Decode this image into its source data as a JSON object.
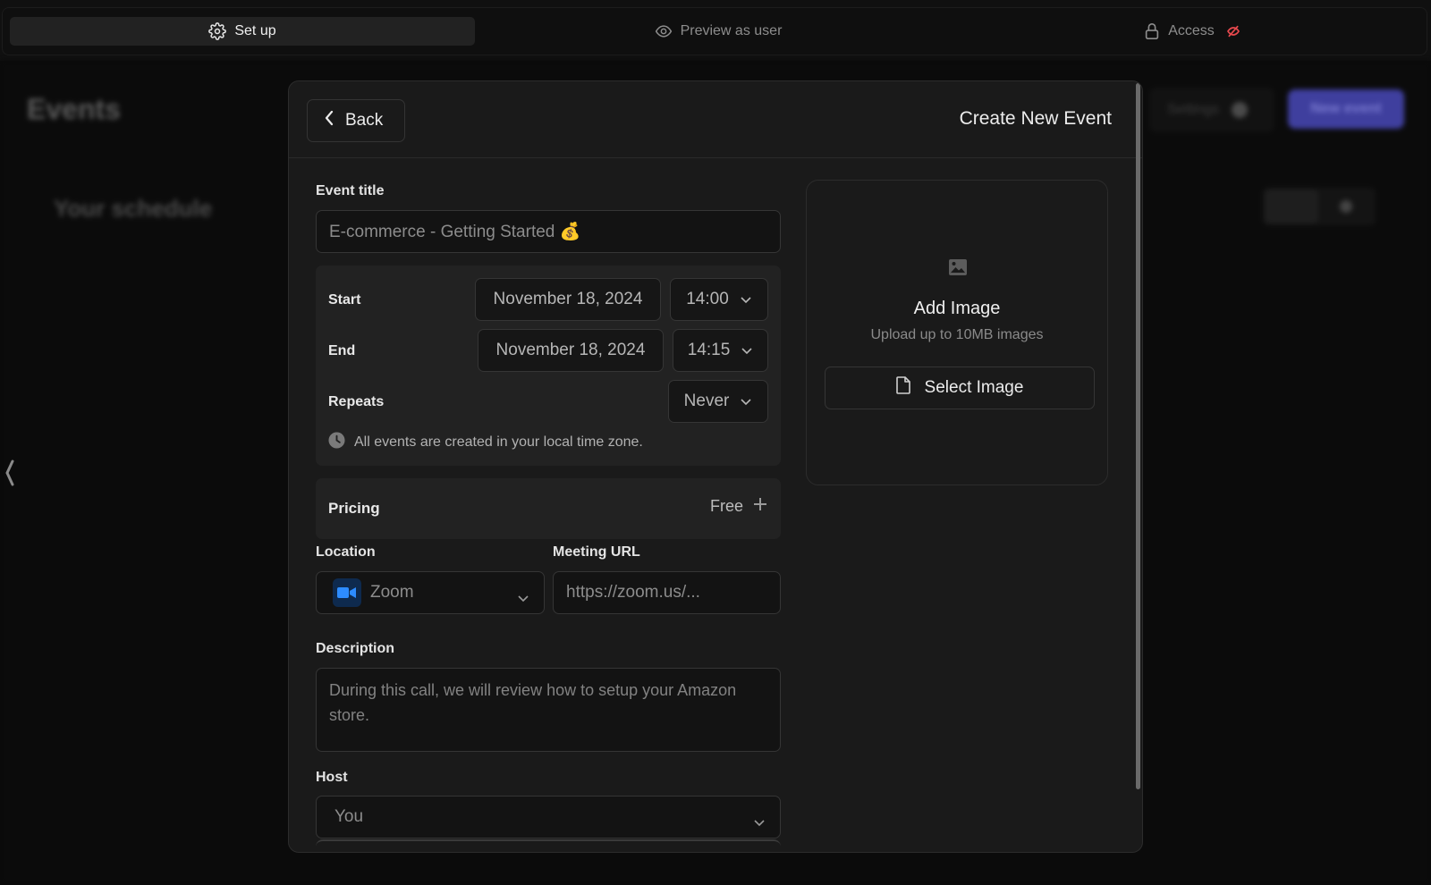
{
  "topbar": {
    "tabs": [
      {
        "label": "Set up",
        "icon": "gear-icon",
        "active": true
      },
      {
        "label": "Preview as user",
        "icon": "eye-icon",
        "active": false
      },
      {
        "label": "Access",
        "icon": "lock-icon",
        "active": false,
        "status_icon": "eye-off-icon",
        "status_color": "#e5484d"
      }
    ]
  },
  "background": {
    "title": "Events",
    "subtitle": "Your schedule",
    "settings_label": "Settings",
    "new_event_label": "New event",
    "accent": "#4a4ac4"
  },
  "modal": {
    "back_label": "Back",
    "title": "Create New Event",
    "event_title": {
      "label": "Event title",
      "placeholder": "E-commerce - Getting Started 💰"
    },
    "schedule": {
      "start_label": "Start",
      "start_date": "November 18, 2024",
      "start_time": "14:00",
      "end_label": "End",
      "end_date": "November 18, 2024",
      "end_time": "14:15",
      "repeats_label": "Repeats",
      "repeats_value": "Never",
      "timezone_note": "All events are created in your local time zone."
    },
    "pricing": {
      "label": "Pricing",
      "value": "Free"
    },
    "location": {
      "label": "Location",
      "value": "Zoom",
      "icon_color": "#2d8cff"
    },
    "meeting_url": {
      "label": "Meeting URL",
      "placeholder": "https://zoom.us/..."
    },
    "description": {
      "label": "Description",
      "placeholder": "During this call, we will review how to setup your Amazon store."
    },
    "host": {
      "label": "Host",
      "value": "You"
    },
    "image": {
      "title": "Add Image",
      "note": "Upload up to 10MB images",
      "button_label": "Select Image"
    }
  }
}
